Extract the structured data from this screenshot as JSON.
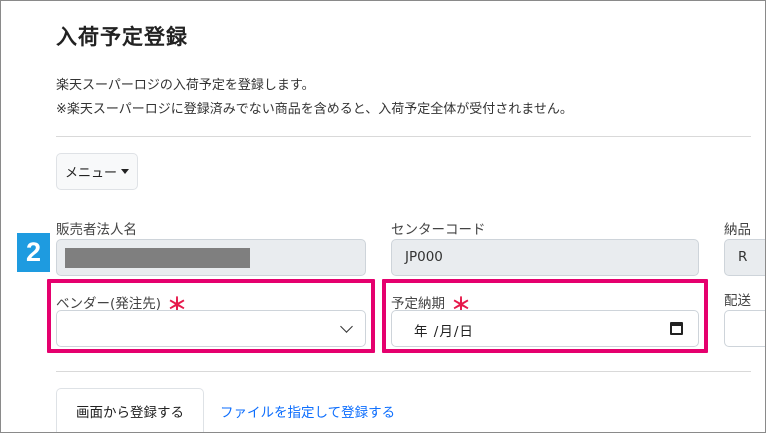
{
  "page": {
    "title": "入荷予定登録",
    "description_1": "楽天スーパーロジの入荷予定を登録します。",
    "description_2": "※楽天スーパーロジに登録済みでない商品を含めると、入荷予定全体が受付されません。"
  },
  "menu": {
    "label": "メニュー"
  },
  "step_badge": "2",
  "fields": {
    "seller_name": {
      "label": "販売者法人名",
      "value": ""
    },
    "center_code": {
      "label": "センターコード",
      "value": "JP000"
    },
    "delivery": {
      "label": "納品",
      "value": "R"
    },
    "vendor": {
      "label": "ベンダー(発注先)",
      "required_mark": "＊",
      "value": ""
    },
    "scheduled_date": {
      "label": "予定納期",
      "required_mark": "＊",
      "placeholder": "年 /月/日"
    },
    "shipping": {
      "label": "配送"
    }
  },
  "tabs": {
    "screen_register": "画面から登録する",
    "file_register": "ファイルを指定して登録する"
  },
  "colors": {
    "highlight": "#e5006e",
    "badge": "#1e9be0",
    "required": "#e6194b",
    "link": "#0d6efd"
  }
}
